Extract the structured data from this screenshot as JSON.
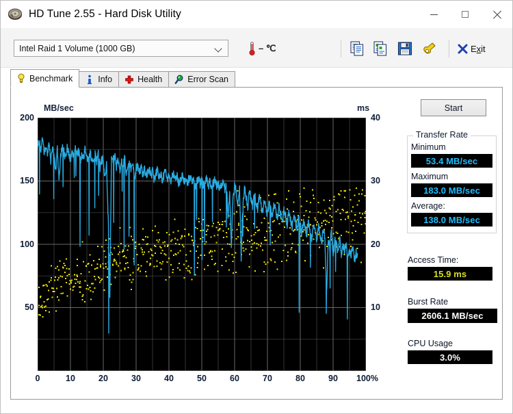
{
  "window": {
    "title": "HD Tune 2.55 - Hard Disk Utility",
    "app_icon": "hard-disk-icon",
    "minimize": "–",
    "maximize": "□",
    "close": "✕"
  },
  "toolbar": {
    "drive_selected": "Intel   Raid 1 Volume (1000 GB)",
    "drive_options": [
      "Intel   Raid 1 Volume (1000 GB)"
    ],
    "temperature": "– ℃",
    "temp_icon": "thermometer-icon",
    "icons": [
      {
        "name": "copy-icon",
        "label": "Copy"
      },
      {
        "name": "copy-screenshot-icon",
        "label": "Copy screenshot"
      },
      {
        "name": "save-icon",
        "label": "Save"
      },
      {
        "name": "options-icon",
        "label": "Options"
      }
    ],
    "exit_label": "Exit",
    "exit_accel": "x",
    "exit_icon": "close-x-icon"
  },
  "tabs": [
    {
      "label": "Benchmark",
      "icon": "lightbulb-icon",
      "active": true
    },
    {
      "label": "Info",
      "icon": "info-icon",
      "active": false
    },
    {
      "label": "Health",
      "icon": "red-cross-icon",
      "active": false
    },
    {
      "label": "Error Scan",
      "icon": "magnifier-icon",
      "active": false
    }
  ],
  "panel": {
    "start_label": "Start",
    "transfer_rate": {
      "legend": "Transfer Rate",
      "minimum_label": "Minimum",
      "minimum_value": "53.4 MB/sec",
      "maximum_label": "Maximum",
      "maximum_value": "183.0 MB/sec",
      "average_label": "Average:",
      "average_value": "138.0 MB/sec"
    },
    "access_time_label": "Access Time:",
    "access_time_value": "15.9 ms",
    "burst_rate_label": "Burst Rate",
    "burst_rate_value": "2606.1 MB/sec",
    "cpu_usage_label": "CPU Usage",
    "cpu_usage_value": "3.0%"
  },
  "colors": {
    "transfer_line": "#29ABE2",
    "access_dots": "#F2E600",
    "plot_background": "#000000",
    "grid": "#7a7a7a",
    "value_cyan": "#20BDFD",
    "value_yellow": "#D9E021",
    "value_white": "#FFFFFF"
  },
  "chart_data": {
    "type": "line",
    "title": "",
    "xlabel": "",
    "ylabel": "MB/sec",
    "y2label": "ms",
    "xlim": [
      0,
      100
    ],
    "ylim": [
      0,
      200
    ],
    "y2lim": [
      0,
      40
    ],
    "grid": true,
    "legend": "none",
    "xticks": [
      0,
      10,
      20,
      30,
      40,
      50,
      60,
      70,
      80,
      90,
      100
    ],
    "xticklabels": [
      "0",
      "10",
      "20",
      "30",
      "40",
      "50",
      "60",
      "70",
      "80",
      "90",
      "100%"
    ],
    "yticks": [
      50,
      100,
      150,
      200
    ],
    "yticklabels": [
      "50",
      "100",
      "150",
      "200"
    ],
    "y2ticks": [
      10,
      20,
      30,
      40
    ],
    "y2ticklabels": [
      "10",
      "20",
      "30",
      "40"
    ],
    "x_unit": "percent of capacity",
    "series": [
      {
        "name": "Transfer Rate",
        "axis": "left",
        "unit": "MB/sec",
        "color": "#29ABE2",
        "style": "line",
        "x": [
          0.0,
          0.5,
          1.0,
          1.5,
          2.0,
          2.5,
          3.0,
          3.5,
          4.0,
          4.5,
          5.0,
          5.5,
          6.0,
          6.5,
          7.0,
          7.5,
          8.0,
          8.5,
          9.0,
          9.5,
          10.0,
          10.5,
          11.0,
          11.5,
          12.0,
          12.5,
          13.0,
          13.5,
          14.0,
          14.5,
          15.0,
          15.5,
          16.0,
          16.5,
          17.0,
          17.5,
          18.0,
          18.5,
          19.0,
          19.5,
          20.0,
          20.5,
          21.0,
          21.5,
          22.0,
          22.5,
          23.0,
          23.5,
          24.0,
          24.5,
          25.0,
          25.5,
          26.0,
          26.5,
          27.0,
          27.5,
          28.0,
          28.5,
          29.0,
          29.5,
          30.0,
          30.5,
          31.0,
          31.5,
          32.0,
          32.5,
          33.0,
          33.5,
          34.0,
          34.5,
          35.0,
          35.5,
          36.0,
          36.5,
          37.0,
          37.5,
          38.0,
          38.5,
          39.0,
          39.5,
          40.0,
          40.5,
          41.0,
          41.5,
          42.0,
          42.5,
          43.0,
          43.5,
          44.0,
          44.5,
          45.0,
          45.5,
          46.0,
          46.5,
          47.0,
          47.5,
          48.0,
          48.5,
          49.0,
          49.5,
          50.0,
          50.5,
          51.0,
          51.5,
          52.0,
          52.5,
          53.0,
          53.5,
          54.0,
          54.5,
          55.0,
          55.5,
          56.0,
          56.5,
          57.0,
          57.5,
          58.0,
          58.5,
          59.0,
          59.5,
          60.0,
          60.5,
          61.0,
          61.5,
          62.0,
          62.5,
          63.0,
          63.5,
          64.0,
          64.5,
          65.0,
          65.5,
          66.0,
          66.5,
          67.0,
          67.5,
          68.0,
          68.5,
          69.0,
          69.5,
          70.0,
          70.5,
          71.0,
          71.5,
          72.0,
          72.5,
          73.0,
          73.5,
          74.0,
          74.5,
          75.0,
          75.5,
          76.0,
          76.5,
          77.0,
          77.5,
          78.0,
          78.5,
          79.0,
          79.5,
          80.0,
          80.5,
          81.0,
          81.5,
          82.0,
          82.5,
          83.0,
          83.5,
          84.0,
          84.5,
          85.0,
          85.5,
          86.0,
          86.5,
          87.0,
          87.5,
          88.0,
          88.5,
          89.0,
          89.5,
          90.0,
          90.5,
          91.0,
          91.5,
          92.0,
          92.5,
          93.0,
          93.5,
          94.0,
          94.5,
          95.0,
          95.5,
          96.0,
          96.5,
          97.0,
          97.5,
          98.0,
          98.5,
          99.0,
          99.5,
          100.0
        ],
        "y": [
          176,
          181,
          174,
          183,
          172,
          178,
          170,
          181,
          166,
          177,
          172,
          158,
          176,
          150,
          170,
          177,
          173,
          168,
          176,
          171,
          165,
          174,
          169,
          176,
          170,
          174,
          166,
          172,
          168,
          176,
          170,
          166,
          174,
          163,
          168,
          171,
          165,
          172,
          160,
          166,
          169,
          151,
          163,
          120,
          60,
          168,
          166,
          170,
          161,
          167,
          158,
          166,
          163,
          169,
          156,
          163,
          166,
          159,
          165,
          152,
          160,
          163,
          156,
          161,
          155,
          160,
          152,
          157,
          160,
          153,
          158,
          151,
          156,
          159,
          152,
          156,
          150,
          155,
          158,
          151,
          155,
          149,
          153,
          156,
          150,
          154,
          148,
          152,
          155,
          149,
          153,
          147,
          151,
          154,
          148,
          152,
          146,
          150,
          153,
          147,
          151,
          145,
          149,
          152,
          146,
          150,
          144,
          148,
          151,
          145,
          149,
          143,
          147,
          150,
          144,
          148,
          119,
          140,
          96,
          138,
          146,
          142,
          132,
          145,
          90,
          130,
          144,
          138,
          128,
          142,
          137,
          130,
          140,
          134,
          127,
          138,
          132,
          125,
          136,
          130,
          123,
          134,
          128,
          121,
          132,
          126,
          119,
          130,
          124,
          117,
          128,
          122,
          115,
          126,
          120,
          113,
          124,
          118,
          111,
          122,
          116,
          109,
          120,
          114,
          107,
          118,
          112,
          105,
          116,
          110,
          103,
          114,
          108,
          101,
          112,
          106,
          61,
          104,
          96,
          110,
          92,
          103,
          99,
          94,
          106,
          90,
          98,
          95,
          101,
          88,
          96,
          92,
          99,
          87,
          94,
          90
        ]
      },
      {
        "name": "Access Time",
        "axis": "right",
        "unit": "ms",
        "color": "#F2E600",
        "style": "scatter",
        "approx_range_ms": [
          8,
          29
        ],
        "trend": "increasing from ~11 ms at 0% to ~25 ms at 100%",
        "mean_ms": 15.9
      }
    ]
  }
}
